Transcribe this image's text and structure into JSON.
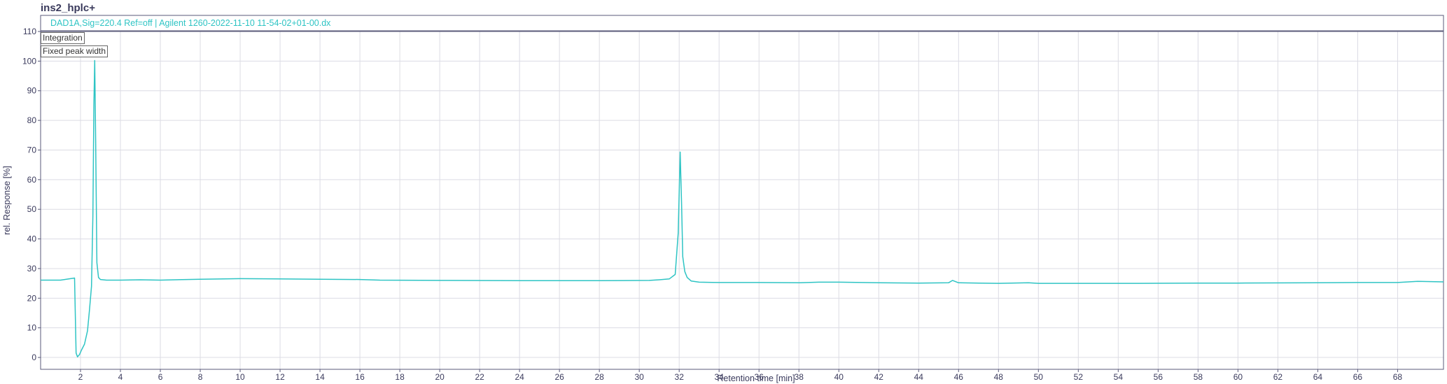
{
  "chart_data": {
    "type": "line",
    "title": "ins2_hplc+",
    "legend": "DAD1A,Sig=220.4  Ref=off | Agilent 1260-2022-11-10 11-54-02+01-00.dx",
    "xlabel": "Retention time [min]",
    "ylabel": "rel. Response [%]",
    "xlim": [
      0,
      70.3
    ],
    "ylim": [
      -4,
      110
    ],
    "xticks": [
      2,
      4,
      6,
      8,
      10,
      12,
      14,
      16,
      18,
      20,
      22,
      24,
      26,
      28,
      30,
      32,
      34,
      36,
      38,
      40,
      42,
      44,
      46,
      48,
      50,
      52,
      54,
      56,
      58,
      60,
      62,
      64,
      66,
      68
    ],
    "yticks": [
      0,
      10,
      20,
      30,
      40,
      50,
      60,
      70,
      80,
      90,
      100,
      110
    ],
    "grid": true,
    "series_color": "#2ec4c4",
    "series": [
      {
        "x": [
          0,
          1.0,
          1.7,
          1.78,
          1.85,
          1.95,
          2.05,
          2.2,
          2.35,
          2.45,
          2.55,
          2.62,
          2.67,
          2.71,
          2.76,
          2.82,
          2.9,
          3.0,
          3.3,
          4.0,
          5.0,
          6.0,
          8.0,
          10.0,
          12.0,
          14.0,
          16.0,
          17.0,
          20.0,
          24.0,
          28.0,
          30.5,
          31.0,
          31.5,
          31.8,
          31.95,
          32.05,
          32.12,
          32.18,
          32.28,
          32.4,
          32.6,
          33.0,
          34.0,
          36.0,
          38.0,
          39.0,
          40.0,
          42.0,
          44.0,
          45.5,
          45.7,
          46.0,
          48.0,
          49.5,
          50.0,
          52.0,
          55.0,
          58.0,
          60.0,
          64.0,
          66.0,
          68.0,
          69.0,
          70.3
        ],
        "y": [
          26.1,
          26.1,
          26.8,
          1.5,
          0.2,
          1.0,
          2.5,
          4.5,
          9.0,
          16.0,
          24.0,
          48.0,
          85.0,
          100.2,
          72.0,
          32.0,
          27.0,
          26.3,
          26.1,
          26.1,
          26.2,
          26.1,
          26.4,
          26.6,
          26.5,
          26.4,
          26.3,
          26.1,
          26.0,
          25.9,
          25.9,
          26.0,
          26.2,
          26.5,
          28.0,
          42.0,
          69.3,
          52.0,
          34.0,
          29.0,
          27.0,
          25.8,
          25.4,
          25.3,
          25.3,
          25.2,
          25.4,
          25.4,
          25.2,
          25.1,
          25.2,
          26.0,
          25.2,
          25.0,
          25.2,
          25.0,
          25.0,
          25.0,
          25.1,
          25.1,
          25.2,
          25.3,
          25.3,
          25.7,
          25.5
        ]
      }
    ]
  },
  "buttons": {
    "integration": "Integration",
    "fixed_peak_width": "Fixed peak width"
  }
}
